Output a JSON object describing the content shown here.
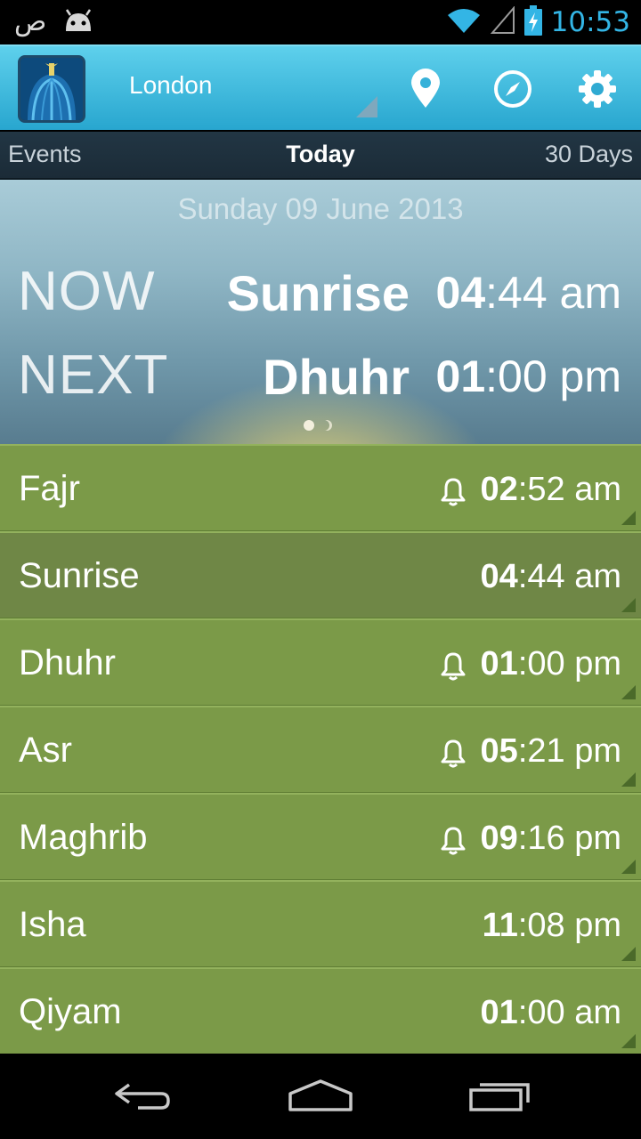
{
  "status_bar": {
    "notification_glyph": "ص",
    "time": "10:53",
    "icons": [
      "arabic-notification-icon",
      "android-icon",
      "wifi-icon",
      "signal-icon",
      "battery-charging-icon"
    ]
  },
  "action_bar": {
    "location": "London",
    "icons": [
      "app-mosque-icon",
      "location-pin-icon",
      "compass-icon",
      "settings-gear-icon"
    ]
  },
  "tabs": [
    {
      "label": "Events"
    },
    {
      "label": "Today"
    },
    {
      "label": "30 Days"
    }
  ],
  "hero": {
    "date": "Sunday 09 June 2013",
    "now_label": "NOW",
    "next_label": "NEXT",
    "now_prayer": "Sunrise",
    "now_time_hour": "04",
    "now_time_rest": ":44 am",
    "next_prayer": "Dhuhr",
    "next_time_hour": "01",
    "next_time_rest": ":00 pm"
  },
  "prayers": [
    {
      "name": "Fajr",
      "hour": "02",
      "rest": ":52 am",
      "alarm": true
    },
    {
      "name": "Sunrise",
      "hour": "04",
      "rest": ":44 am",
      "alarm": false
    },
    {
      "name": "Dhuhr",
      "hour": "01",
      "rest": ":00 pm",
      "alarm": true
    },
    {
      "name": "Asr",
      "hour": "05",
      "rest": ":21 pm",
      "alarm": true
    },
    {
      "name": "Maghrib",
      "hour": "09",
      "rest": ":16 pm",
      "alarm": true
    },
    {
      "name": "Isha",
      "hour": "11",
      "rest": ":08 pm",
      "alarm": false
    },
    {
      "name": "Qiyam",
      "hour": "01",
      "rest": ":00 am",
      "alarm": false
    }
  ],
  "nav_bar": {
    "icons": [
      "back-icon",
      "home-icon",
      "recent-apps-icon"
    ]
  },
  "colors": {
    "accent_blue": "#33b5e5",
    "list_green": "#7b9a48",
    "current_row_green": "#6f8746"
  }
}
